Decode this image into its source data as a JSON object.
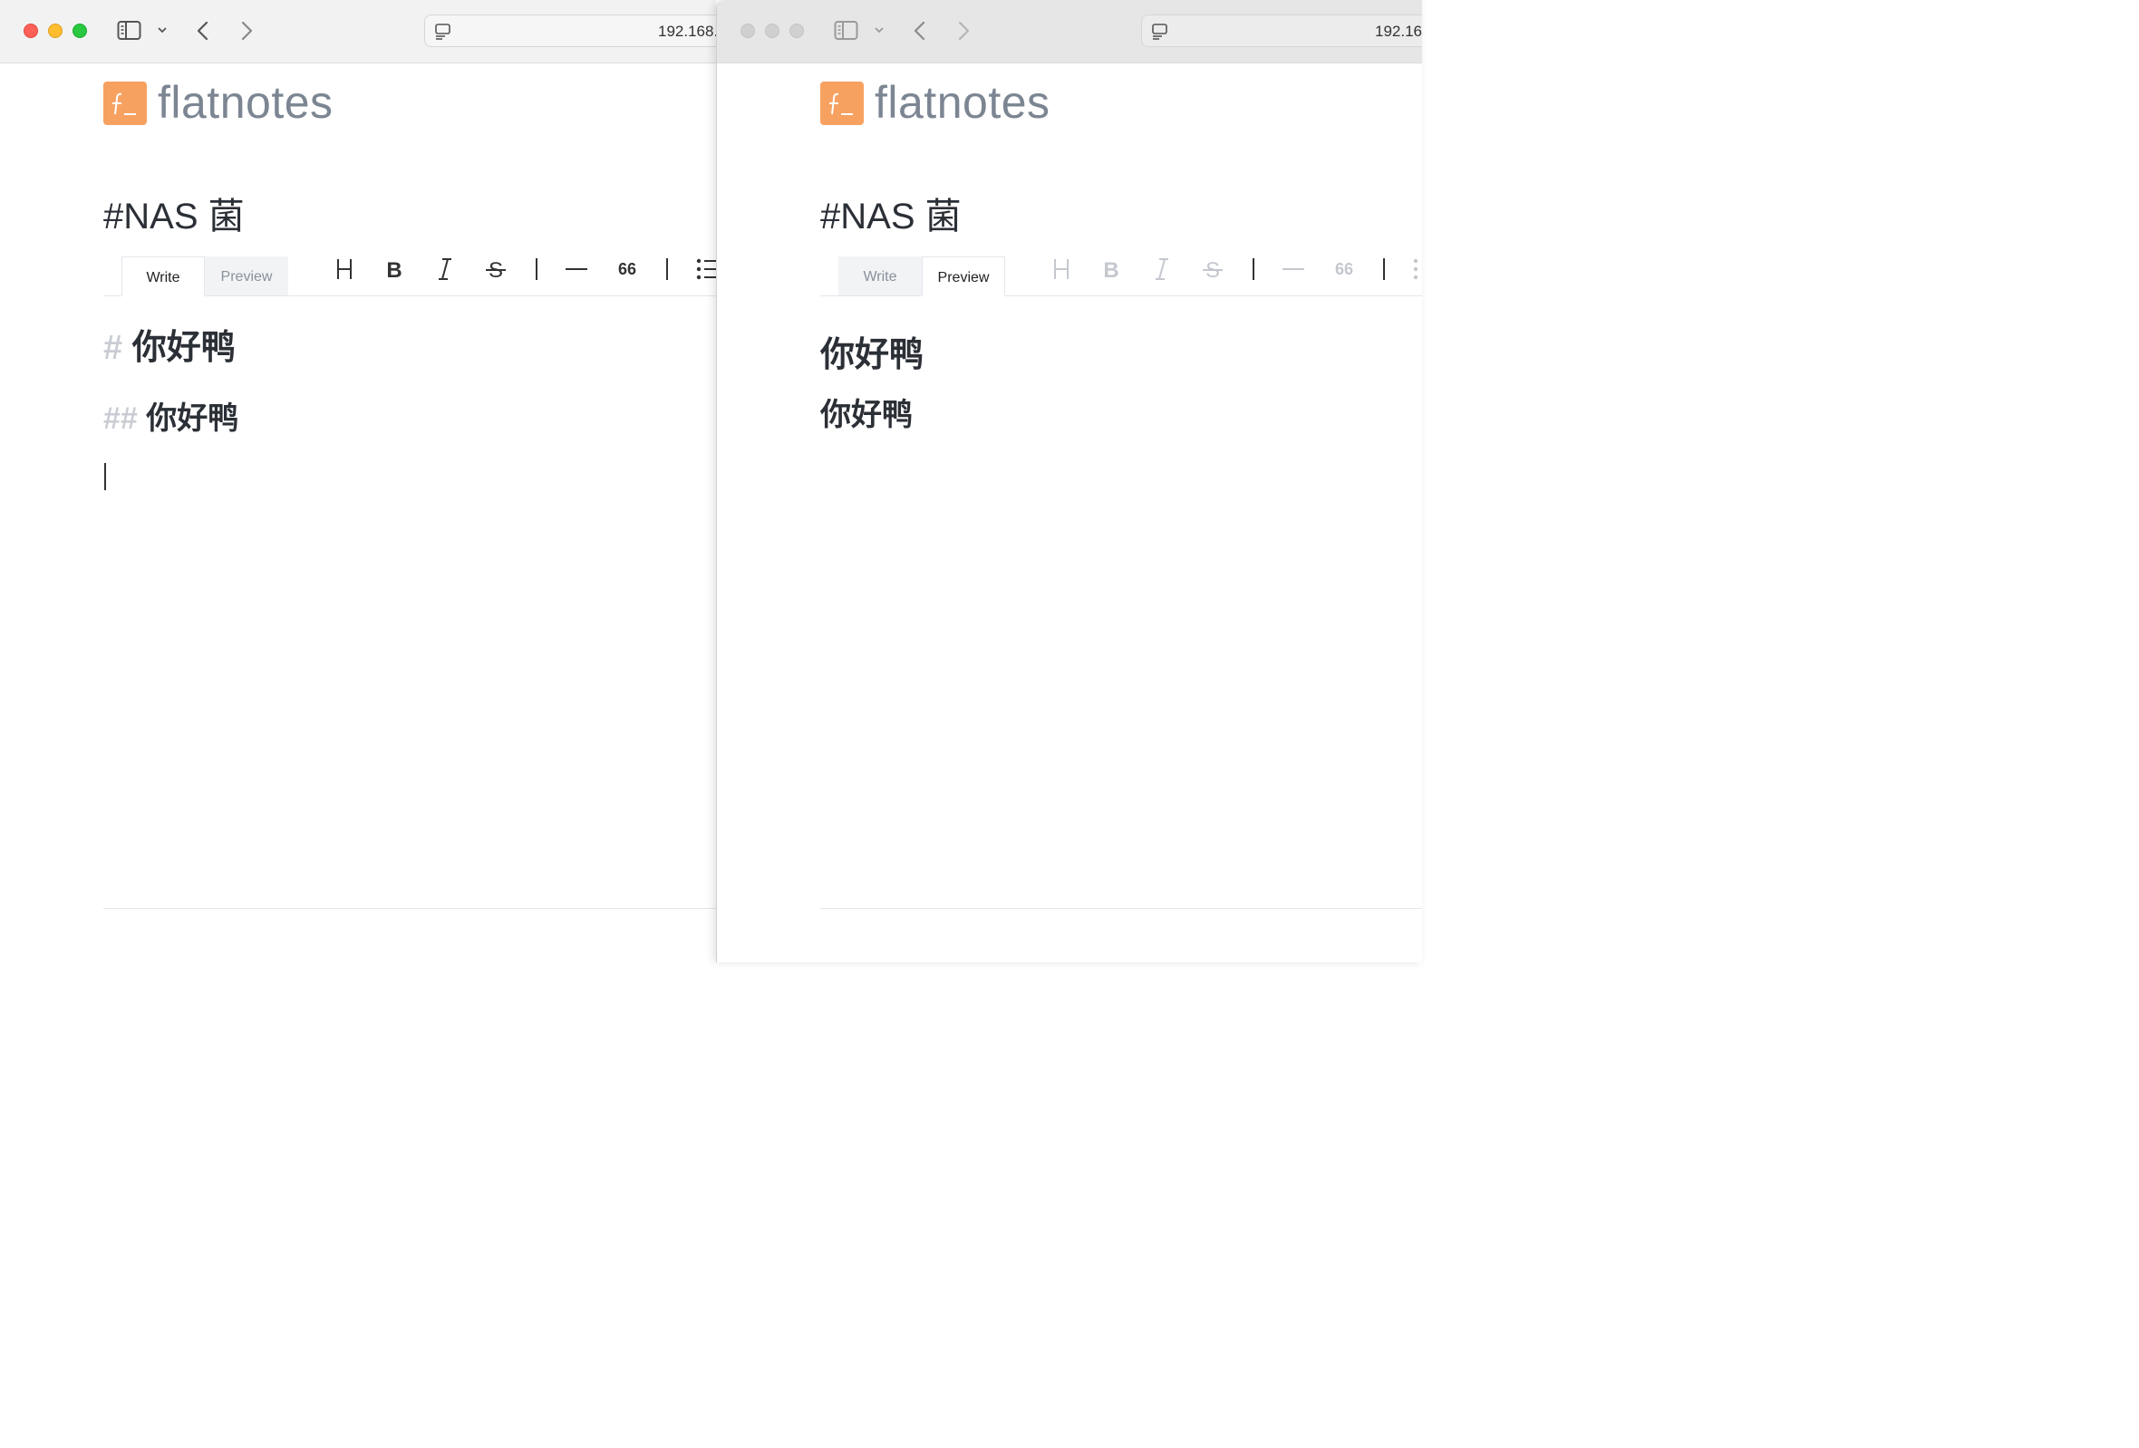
{
  "brand": {
    "name": "flatnotes",
    "logo_glyph": "f_",
    "logo_color": "#f7a161"
  },
  "left": {
    "url": "192.168.",
    "note_title": "#NAS 菌",
    "tabs": {
      "write": "Write",
      "preview": "Preview",
      "active": "write"
    },
    "toolbar": {
      "heading": "H",
      "bold": "B",
      "italic": "I",
      "strike": "S",
      "hr": "—",
      "quote": "66"
    },
    "editor": {
      "line1_mark": "#",
      "line1_text": "你好鸭",
      "line2_mark": "##",
      "line2_text": "你好鸭"
    }
  },
  "right": {
    "url": "192.16",
    "note_title": "#NAS 菌",
    "tabs": {
      "write": "Write",
      "preview": "Preview",
      "active": "preview"
    },
    "toolbar": {
      "heading": "H",
      "bold": "B",
      "italic": "I",
      "strike": "S",
      "hr": "—",
      "quote": "66"
    },
    "preview": {
      "h1": "你好鸭",
      "h2": "你好鸭"
    }
  },
  "colors": {
    "accent": "#f7a161",
    "close": "#fe5f57",
    "minimize": "#febc2e",
    "zoom": "#28c840"
  }
}
